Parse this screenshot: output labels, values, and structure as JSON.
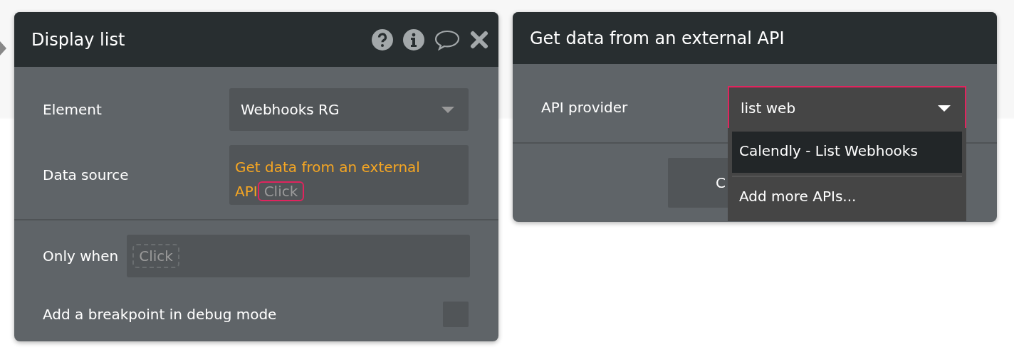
{
  "editor": {
    "title": "Display list",
    "rows": [
      {
        "kind": "select",
        "label": "Element",
        "value": "Webhooks RG"
      },
      {
        "kind": "expression",
        "label": "Data source",
        "value": "Get data from an external API",
        "click": "Click",
        "highlighted": true
      },
      {
        "kind": "condition",
        "label": "Only when",
        "click": "Click",
        "highlighted": false
      },
      {
        "kind": "checkbox",
        "label": "Add a breakpoint in debug mode",
        "checked": false
      }
    ]
  },
  "api_panel": {
    "title": "Get data from an external API",
    "field_label": "API provider",
    "field_value": "list web",
    "focused": true,
    "button": "C",
    "options": [
      {
        "label": "Calendly - List Webhooks",
        "selected": true
      },
      {
        "label": "Add more APIs...",
        "selected": false
      }
    ]
  }
}
